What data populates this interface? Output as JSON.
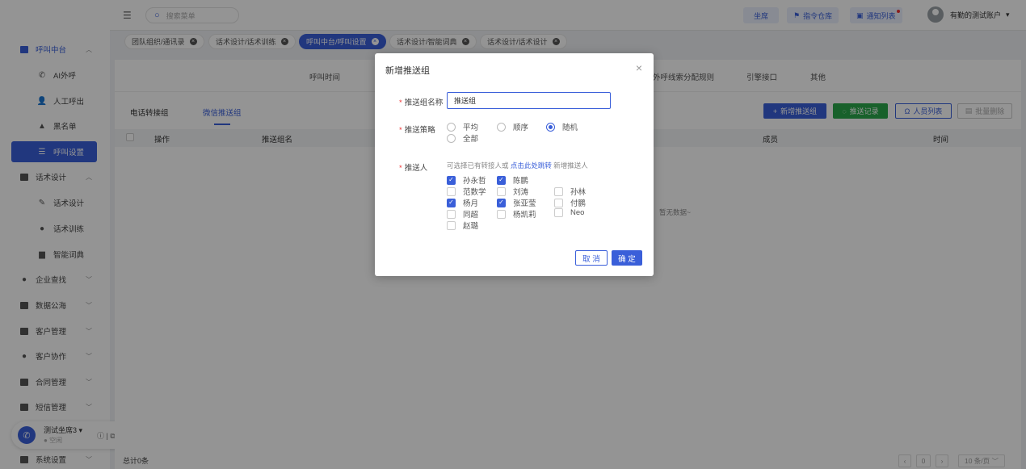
{
  "topbar": {
    "search_placeholder": "搜索菜单",
    "seat_label": "坐席",
    "instructions_label": "指令仓库",
    "notifications_label": "通知列表",
    "account_name": "有勤的测试账户"
  },
  "tabs": [
    {
      "label": "团队组织/通讯录"
    },
    {
      "label": "话术设计/话术训练"
    },
    {
      "label": "呼叫中台/呼叫设置"
    },
    {
      "label": "话术设计/智能词典"
    },
    {
      "label": "话术设计/话术设计"
    }
  ],
  "sidebar": {
    "call_center": "呼叫中台",
    "ai_call": "AI外呼",
    "manual_call": "人工呼出",
    "blacklist": "黑名单",
    "call_settings": "呼叫设置",
    "script_design_group": "话术设计",
    "script_design": "话术设计",
    "script_training": "话术训练",
    "smart_dict": "智能词典",
    "enterprise_search": "企业查找",
    "data_sea": "数据公海",
    "customer_mgmt": "客户管理",
    "customer_collab": "客户协作",
    "contract_mgmt": "合同管理",
    "sms_mgmt": "短信管理",
    "system_settings": "系统设置"
  },
  "user": {
    "name": "测试坐席3",
    "status": "空闲"
  },
  "subnav": {
    "items": [
      "呼叫时间",
      "外呼线索分配规则",
      "引擎接口",
      "其他"
    ]
  },
  "panel": {
    "tab_transfer": "电话转接组",
    "tab_wechat": "微信推送组",
    "btn_add": "新增推送组",
    "btn_records": "推送记录",
    "btn_people": "人员列表",
    "btn_batch_delete": "批量删除",
    "col_actions": "操作",
    "col_group_name": "推送组名",
    "col_members": "成员",
    "col_time": "时间",
    "empty_text": "暂无数据~",
    "total": "总计0条",
    "page_current": "0",
    "page_size": "10 条/页"
  },
  "dialog": {
    "title": "新增推送组",
    "name_label": "推送组名称",
    "name_value": "推送组",
    "strategy_label": "推送策略",
    "strategies": [
      {
        "label": "平均",
        "checked": false
      },
      {
        "label": "顺序",
        "checked": false
      },
      {
        "label": "随机",
        "checked": true
      },
      {
        "label": "全部",
        "checked": false
      }
    ],
    "pusher_label": "推送人",
    "hint_prefix": "可选择已有转接人或",
    "hint_link": "点击此处跳转",
    "hint_suffix": "新增推送人",
    "people": [
      {
        "name": "孙永哲",
        "checked": true
      },
      {
        "name": "陈鹏",
        "checked": true
      },
      {
        "name": "范数学",
        "checked": false
      },
      {
        "name": "刘涛",
        "checked": false
      },
      {
        "name": "孙林",
        "checked": false
      },
      {
        "name": "杨月",
        "checked": true
      },
      {
        "name": "张亚莹",
        "checked": true
      },
      {
        "name": "付鹏",
        "checked": false
      },
      {
        "name": "同超",
        "checked": false
      },
      {
        "name": "杨凯莉",
        "checked": false
      },
      {
        "name": "Neo",
        "checked": false
      },
      {
        "name": "赵璐",
        "checked": false
      }
    ],
    "cancel_label": "取 消",
    "ok_label": "确 定"
  },
  "colors": {
    "accent": "#3a5fd9",
    "green": "#2aa84a"
  }
}
